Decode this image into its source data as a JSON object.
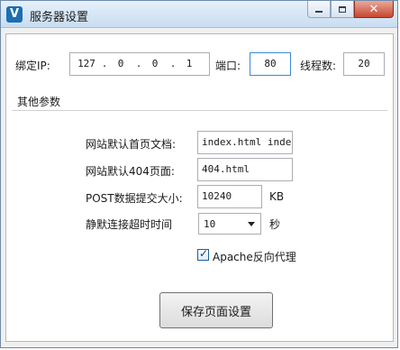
{
  "window": {
    "title": "服务器设置",
    "app_icon_letter": "V"
  },
  "caption_buttons": {
    "close_glyph": "✕"
  },
  "server": {
    "ip_label": "绑定IP:",
    "ip_segments": [
      "127",
      "0",
      "0",
      "1"
    ],
    "ip_dot": ".",
    "port_label": "端口:",
    "port_value": "80",
    "threads_label": "线程数:",
    "threads_value": "20"
  },
  "other": {
    "group_title": "其他参数",
    "index_label": "网站默认首页文档:",
    "index_value": "index.html index",
    "page404_label": "网站默认404页面:",
    "page404_value": "404.html",
    "post_label": "POST数据提交大小:",
    "post_value": "10240",
    "post_unit": "KB",
    "timeout_label": "静默连接超时时间",
    "timeout_value": "10",
    "timeout_unit": "秒",
    "apache_label": "Apache反向代理",
    "apache_checked": true
  },
  "actions": {
    "save_label": "保存页面设置"
  },
  "colors": {
    "titlebar": "#c9ddf1",
    "close_button": "#c8472f",
    "accent_focus": "#3a8ad6"
  }
}
